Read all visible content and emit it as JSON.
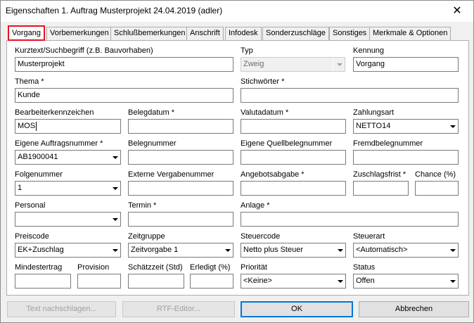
{
  "window": {
    "title": "Eigenschaften 1. Auftrag Musterprojekt 24.04.2019 (adler)",
    "close_symbol": "✕"
  },
  "tabs": [
    {
      "label": "Vorgang",
      "active": true
    },
    {
      "label": "Vorbemerkungen"
    },
    {
      "label": "Schlußbemerkungen"
    },
    {
      "label": "Anschrift"
    },
    {
      "label": "Infodesk"
    },
    {
      "label": "Sonderzuschläge"
    },
    {
      "label": "Sonstiges"
    },
    {
      "label": "Merkmale & Optionen"
    }
  ],
  "form": {
    "kurztext": {
      "label": "Kurztext/Suchbegriff (z.B. Bauvorhaben)",
      "value": "Musterprojekt"
    },
    "typ": {
      "label": "Typ",
      "value": "Zweig"
    },
    "kennung": {
      "label": "Kennung",
      "value": "Vorgang"
    },
    "thema": {
      "label": "Thema *",
      "value": "Kunde"
    },
    "stichwoerter": {
      "label": "Stichwörter *",
      "value": ""
    },
    "bearbeiter": {
      "label": "Bearbeiterkennzeichen",
      "value": "MOS"
    },
    "belegdatum": {
      "label": "Belegdatum *",
      "value": ""
    },
    "valutadatum": {
      "label": "Valutadatum *",
      "value": ""
    },
    "zahlungsart": {
      "label": "Zahlungsart",
      "value": "NETTO14"
    },
    "eigene_auftragsnummer": {
      "label": "Eigene Auftragsnummer *",
      "value": "AB1900041"
    },
    "belegnummer": {
      "label": "Belegnummer",
      "value": ""
    },
    "eigene_quellbelegnummer": {
      "label": "Eigene Quellbelegnummer",
      "value": ""
    },
    "fremdbelegnummer": {
      "label": "Fremdbelegnummer",
      "value": ""
    },
    "folgenummer": {
      "label": "Folgenummer",
      "value": "1"
    },
    "externe_vergabenummer": {
      "label": "Externe Vergabenummer",
      "value": ""
    },
    "angebotsabgabe": {
      "label": "Angebotsabgabe *",
      "value": ""
    },
    "zuschlagsfrist": {
      "label": "Zuschlagsfrist *",
      "value": ""
    },
    "chance": {
      "label": "Chance (%)",
      "value": ""
    },
    "personal": {
      "label": "Personal",
      "value": ""
    },
    "termin": {
      "label": "Termin *",
      "value": ""
    },
    "anlage": {
      "label": "Anlage *",
      "value": ""
    },
    "preiscode": {
      "label": "Preiscode",
      "value": "EK+Zuschlag"
    },
    "zeitgruppe": {
      "label": "Zeitgruppe",
      "value": "Zeitvorgabe 1"
    },
    "steuercode": {
      "label": "Steuercode",
      "value": "Netto plus Steuer"
    },
    "steuerart": {
      "label": "Steuerart",
      "value": "<Automatisch>"
    },
    "mindestertrag": {
      "label": "Mindestertrag",
      "value": ""
    },
    "provision": {
      "label": "Provision",
      "value": ""
    },
    "schaetzzeit": {
      "label": "Schätzzeit (Std)",
      "value": ""
    },
    "erledigt": {
      "label": "Erledigt (%)",
      "value": ""
    },
    "prioritaet": {
      "label": "Priorität",
      "value": "<Keine>"
    },
    "status": {
      "label": "Status",
      "value": "Offen"
    }
  },
  "buttons": {
    "text_nachschlagen": "Text nachschlagen...",
    "rtf_editor": "RTF-Editor...",
    "ok": "OK",
    "abbrechen": "Abbrechen"
  }
}
